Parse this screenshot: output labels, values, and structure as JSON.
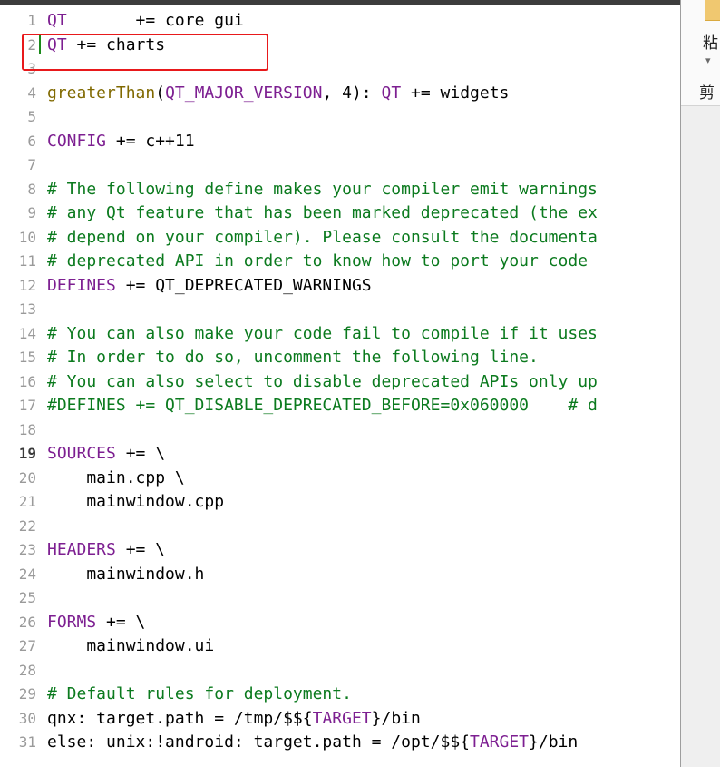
{
  "editor": {
    "lines": [
      {
        "num": "1",
        "tokens": [
          {
            "t": "QT",
            "c": "kw"
          },
          {
            "t": "       += core gui"
          }
        ]
      },
      {
        "num": "2",
        "tokens": [
          {
            "t": "QT",
            "c": "kw"
          },
          {
            "t": " += charts"
          }
        ]
      },
      {
        "num": "3",
        "tokens": []
      },
      {
        "num": "4",
        "tokens": [
          {
            "t": "greaterThan",
            "c": "fn"
          },
          {
            "t": "("
          },
          {
            "t": "QT_MAJOR_VERSION",
            "c": "kw"
          },
          {
            "t": ", 4): "
          },
          {
            "t": "QT",
            "c": "kw"
          },
          {
            "t": " += widgets"
          }
        ]
      },
      {
        "num": "5",
        "tokens": []
      },
      {
        "num": "6",
        "tokens": [
          {
            "t": "CONFIG",
            "c": "kw"
          },
          {
            "t": " += c++11"
          }
        ]
      },
      {
        "num": "7",
        "tokens": []
      },
      {
        "num": "8",
        "tokens": [
          {
            "t": "# The following define makes your compiler emit warnings",
            "c": "cm"
          }
        ]
      },
      {
        "num": "9",
        "tokens": [
          {
            "t": "# any Qt feature that has been marked deprecated (the ex",
            "c": "cm"
          }
        ]
      },
      {
        "num": "10",
        "tokens": [
          {
            "t": "# depend on your compiler). Please consult the documenta",
            "c": "cm"
          }
        ]
      },
      {
        "num": "11",
        "tokens": [
          {
            "t": "# deprecated API in order to know how to port your code ",
            "c": "cm"
          }
        ]
      },
      {
        "num": "12",
        "tokens": [
          {
            "t": "DEFINES",
            "c": "kw"
          },
          {
            "t": " += QT_DEPRECATED_WARNINGS"
          }
        ]
      },
      {
        "num": "13",
        "tokens": []
      },
      {
        "num": "14",
        "tokens": [
          {
            "t": "# You can also make your code fail to compile if it uses",
            "c": "cm"
          }
        ]
      },
      {
        "num": "15",
        "tokens": [
          {
            "t": "# In order to do so, uncomment the following line.",
            "c": "cm"
          }
        ]
      },
      {
        "num": "16",
        "tokens": [
          {
            "t": "# You can also select to disable deprecated APIs only up",
            "c": "cm"
          }
        ]
      },
      {
        "num": "17",
        "tokens": [
          {
            "t": "#DEFINES += QT_DISABLE_DEPRECATED_BEFORE=0x060000    # d",
            "c": "cm"
          }
        ]
      },
      {
        "num": "18",
        "tokens": []
      },
      {
        "num": "19",
        "tokens": [
          {
            "t": "SOURCES",
            "c": "kw"
          },
          {
            "t": " += \\"
          }
        ],
        "current": true
      },
      {
        "num": "20",
        "tokens": [
          {
            "t": "    main.cpp \\"
          }
        ]
      },
      {
        "num": "21",
        "tokens": [
          {
            "t": "    mainwindow.cpp"
          }
        ]
      },
      {
        "num": "22",
        "tokens": []
      },
      {
        "num": "23",
        "tokens": [
          {
            "t": "HEADERS",
            "c": "kw"
          },
          {
            "t": " += \\"
          }
        ]
      },
      {
        "num": "24",
        "tokens": [
          {
            "t": "    mainwindow.h"
          }
        ]
      },
      {
        "num": "25",
        "tokens": []
      },
      {
        "num": "26",
        "tokens": [
          {
            "t": "FORMS",
            "c": "kw"
          },
          {
            "t": " += \\"
          }
        ]
      },
      {
        "num": "27",
        "tokens": [
          {
            "t": "    mainwindow.ui"
          }
        ]
      },
      {
        "num": "28",
        "tokens": []
      },
      {
        "num": "29",
        "tokens": [
          {
            "t": "# Default rules for deployment.",
            "c": "cm"
          }
        ]
      },
      {
        "num": "30",
        "tokens": [
          {
            "t": "qnx: target.path = /tmp/$${"
          },
          {
            "t": "TARGET",
            "c": "kw"
          },
          {
            "t": "}/bin"
          }
        ]
      },
      {
        "num": "31",
        "tokens": [
          {
            "t": "else: unix:!android: target.path = /opt/$${"
          },
          {
            "t": "TARGET",
            "c": "kw"
          },
          {
            "t": "}/bin"
          }
        ]
      }
    ]
  },
  "side_panel": {
    "label_top": "粘",
    "label_bottom": "剪"
  }
}
